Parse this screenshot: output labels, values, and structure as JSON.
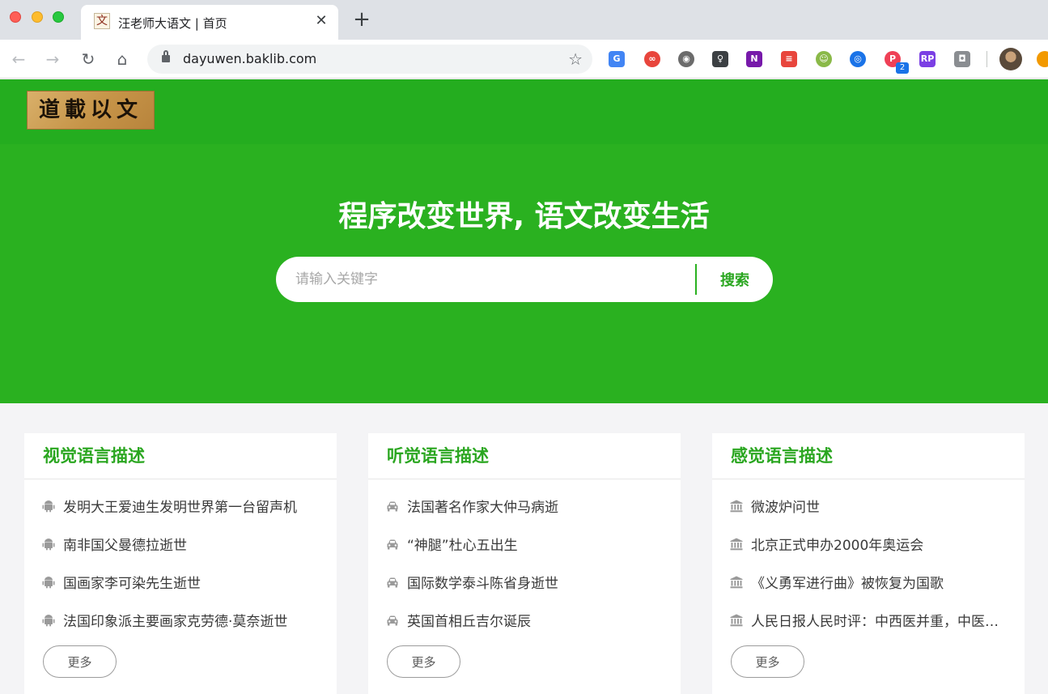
{
  "browser": {
    "tab": {
      "title": "汪老师大语文 | 首页",
      "favicon_glyph": "文",
      "close_glyph": "✕"
    },
    "new_tab_glyph": "+",
    "nav": {
      "back": "←",
      "forward": "→",
      "reload": "↻",
      "home": "⌂"
    },
    "url": "dayuwen.baklib.com",
    "bookmark_glyph": "☆",
    "extensions": [
      {
        "name": "google-translate-icon",
        "color": "#4285f4",
        "glyph": "G"
      },
      {
        "name": "infinity-icon",
        "color": "#e8453c",
        "glyph": "∞"
      },
      {
        "name": "film-reel-icon",
        "color": "#6b6b6b",
        "glyph": "◉"
      },
      {
        "name": "lightbulb-icon",
        "color": "#3c4043",
        "glyph": "♀"
      },
      {
        "name": "onenote-icon",
        "color": "#7719aa",
        "glyph": "N"
      },
      {
        "name": "checklist-icon",
        "color": "#e8453c",
        "glyph": "≡"
      },
      {
        "name": "android-bug-icon",
        "color": "#8ab948",
        "glyph": "☺"
      },
      {
        "name": "compass-icon",
        "color": "#1a73e8",
        "glyph": "◎"
      },
      {
        "name": "pocket-icon",
        "color": "#ef4056",
        "glyph": "P"
      },
      {
        "name": "axure-rp-icon",
        "color": "#7b3fe4",
        "glyph": "RP"
      },
      {
        "name": "camera-icon",
        "color": "#8a8d91",
        "glyph": "◘"
      }
    ],
    "extension_badge": "2"
  },
  "site": {
    "logo_text": "道載以文",
    "hero_title": "程序改变世界, 语文改变生活",
    "search": {
      "placeholder": "请输入关键字",
      "button": "搜索"
    }
  },
  "cards": [
    {
      "title": "视觉语言描述",
      "icon": "android-icon",
      "items": [
        "发明大王爱迪生发明世界第一台留声机",
        "南非国父曼德拉逝世",
        "国画家李可染先生逝世",
        "法国印象派主要画家克劳德·莫奈逝世"
      ],
      "more": "更多"
    },
    {
      "title": "听觉语言描述",
      "icon": "car-icon",
      "items": [
        "法国著名作家大仲马病逝",
        "“神腿”杜心五出生",
        "国际数学泰斗陈省身逝世",
        "英国首相丘吉尔诞辰"
      ],
      "more": "更多"
    },
    {
      "title": "感觉语言描述",
      "icon": "bank-icon",
      "items": [
        "微波炉问世",
        "北京正式申办2000年奥运会",
        "《义勇军进行曲》被恢复为国歌",
        "人民日报人民时评：中西医并重，中医药振兴发展"
      ],
      "more": "更多"
    }
  ]
}
